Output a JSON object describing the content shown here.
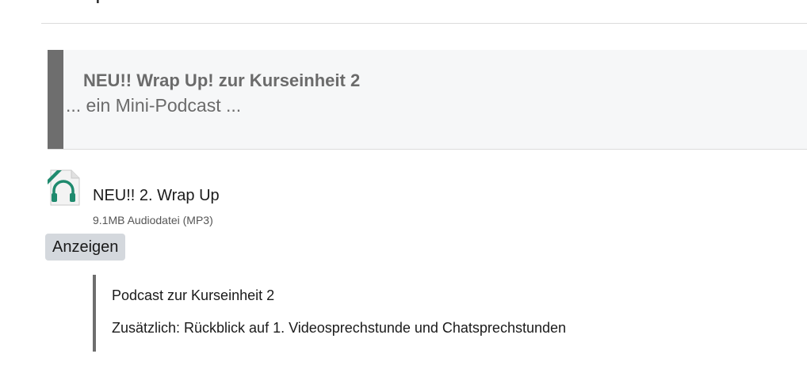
{
  "header": {
    "heading_fragment": "p"
  },
  "section": {
    "title": "NEU!! Wrap Up! zur Kurseinheit 2",
    "subtitle": "... ein Mini-Podcast ...",
    "accent_color": "#6e6e6e"
  },
  "resource": {
    "icon": "audio-headphones-icon",
    "name": "NEU!! 2. Wrap Up",
    "details": "9.1MB Audiodatei (MP3)",
    "show_button_label": "Anzeigen",
    "icon_color": "#1f8a6e"
  },
  "description": {
    "lines": [
      "Podcast zur Kurseinheit 2",
      "Zusätzlich: Rückblick auf 1. Videosprechstunde und Chatsprechstunden"
    ]
  }
}
